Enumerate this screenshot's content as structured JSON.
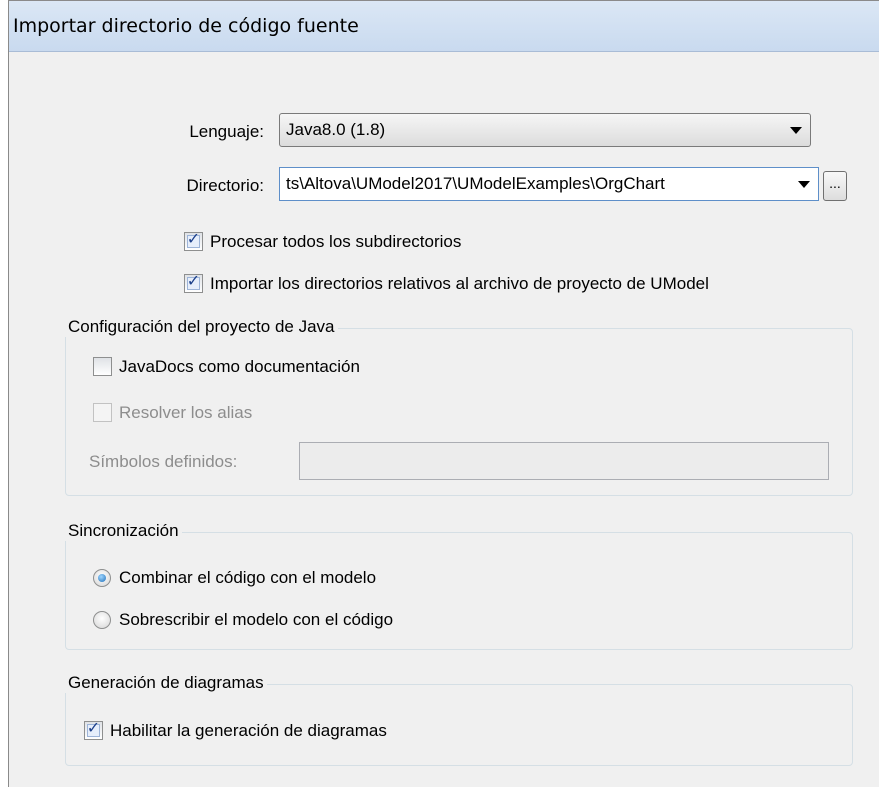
{
  "dialog": {
    "title": "Importar directorio de código fuente"
  },
  "language": {
    "label": "Lenguaje:",
    "value": "Java8.0 (1.8)"
  },
  "directory": {
    "label": "Directorio:",
    "value": "ts\\Altova\\UModel2017\\UModelExamples\\OrgChart",
    "browse_label": "..."
  },
  "options": {
    "process_subdirs": {
      "label": "Procesar todos los subdirectorios",
      "checked": true
    },
    "relative_dirs": {
      "label": "Importar los directorios relativos al archivo de proyecto de UModel",
      "checked": true
    }
  },
  "java_config": {
    "legend": "Configuración del proyecto de Java",
    "javadocs": {
      "label": "JavaDocs como documentación",
      "checked": false
    },
    "resolve_aliases": {
      "label": "Resolver los alias",
      "checked": false,
      "enabled": false
    },
    "defined_symbols": {
      "label": "Símbolos definidos:",
      "value": ""
    }
  },
  "sync": {
    "legend": "Sincronización",
    "merge": {
      "label": "Combinar el código con el modelo",
      "selected": true
    },
    "overwrite": {
      "label": "Sobrescribir el modelo con el código",
      "selected": false
    }
  },
  "diagrams": {
    "legend": "Generación de diagramas",
    "enable": {
      "label": "Habilitar la generación de diagramas",
      "checked": true
    }
  },
  "icons": {
    "check": "check-icon",
    "dropdown": "chevron-down-icon"
  }
}
